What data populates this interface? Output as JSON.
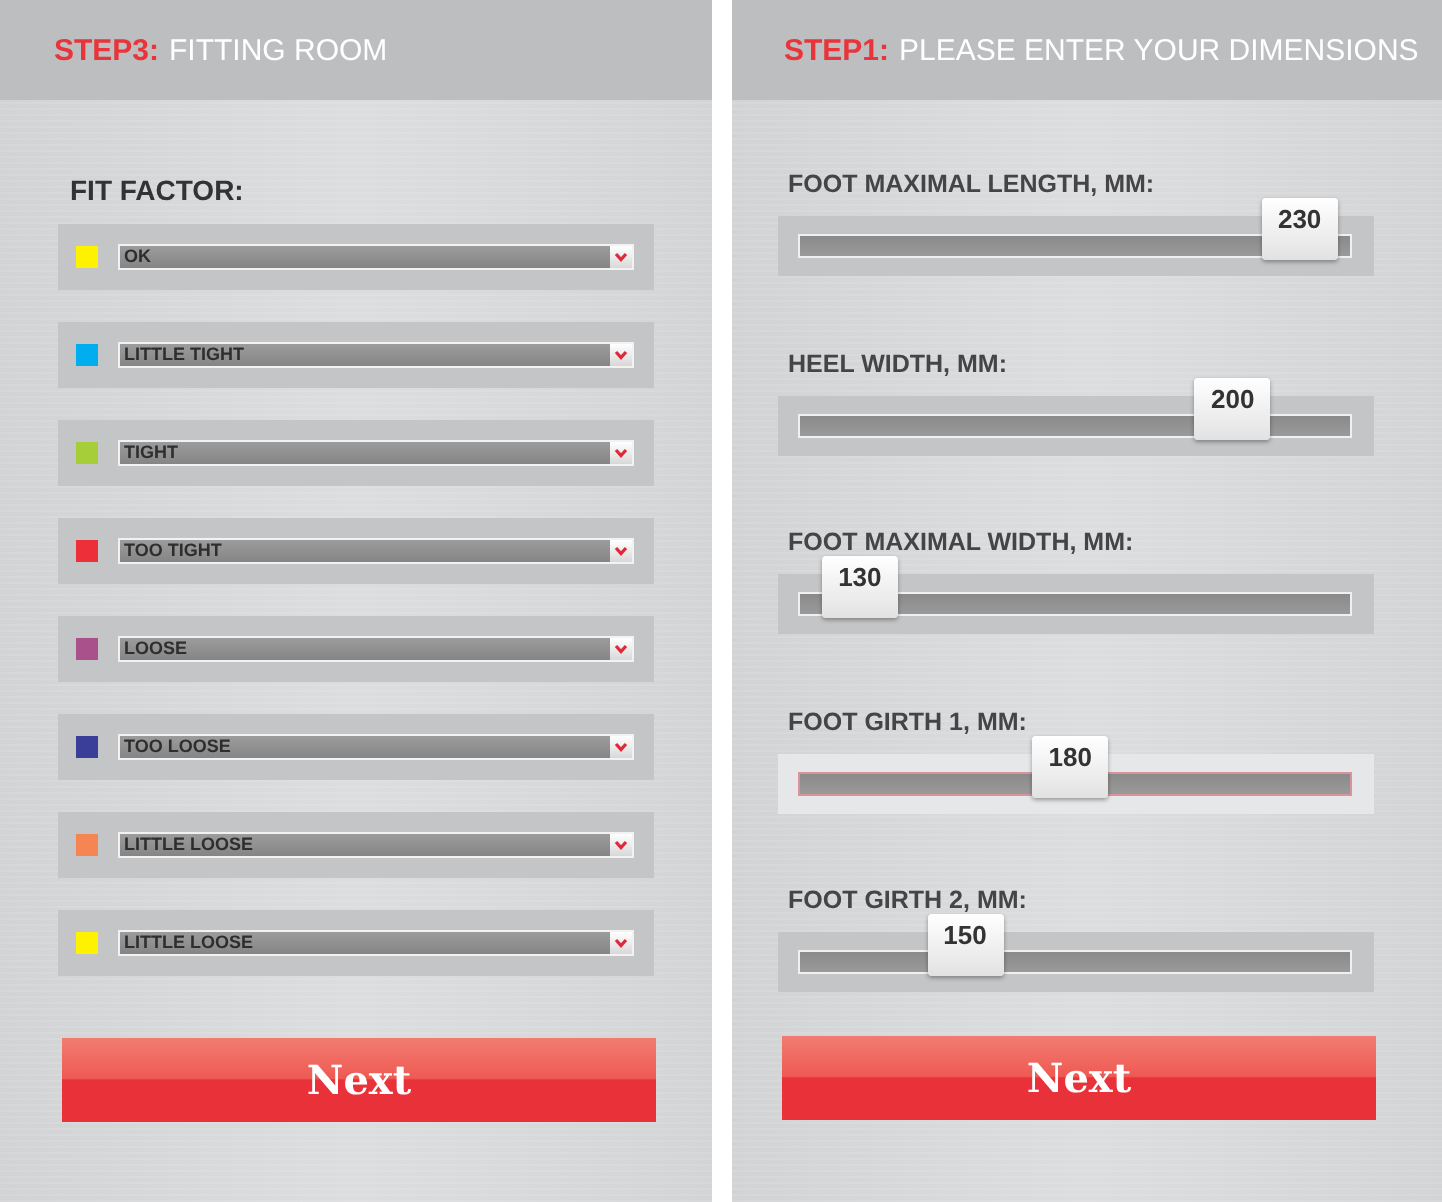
{
  "panels": [
    {
      "kind": "fit_factor",
      "header": {
        "step": "STEP3:",
        "title": "FITTING ROOM"
      },
      "label": "FIT FACTOR:",
      "rows": [
        {
          "color": "#fff200",
          "value": "OK"
        },
        {
          "color": "#00aeef",
          "value": "LITTLE TIGHT"
        },
        {
          "color": "#a6ce39",
          "value": "TIGHT"
        },
        {
          "color": "#ed2f3a",
          "value": "TOO TIGHT"
        },
        {
          "color": "#a8518a",
          "value": "LOOSE"
        },
        {
          "color": "#3b3e98",
          "value": "TOO LOOSE"
        },
        {
          "color": "#f58553",
          "value": "LITTLE LOOSE"
        },
        {
          "color": "#fff200",
          "value": "LITTLE LOOSE"
        }
      ],
      "button": "Next"
    },
    {
      "kind": "dimensions",
      "header": {
        "step": "STEP1:",
        "title": "PLEASE ENTER YOUR DIMENSIONS"
      },
      "sliders": [
        {
          "label": "FOOT MAXIMAL LENGTH, MM:",
          "reading": "230",
          "level": 0.97,
          "focused": false
        },
        {
          "label": "HEEL WIDTH, MM:",
          "reading": "200",
          "level": 0.83,
          "focused": false
        },
        {
          "label": "FOOT MAXIMAL WIDTH, MM:",
          "reading": "130",
          "level": 0.05,
          "focused": false
        },
        {
          "label": "FOOT GIRTH 1, MM:",
          "reading": "180",
          "level": 0.49,
          "focused": true
        },
        {
          "label": "FOOT GIRTH 2, MM:",
          "reading": "150",
          "level": 0.27,
          "focused": false
        }
      ],
      "button": "Next"
    }
  ]
}
